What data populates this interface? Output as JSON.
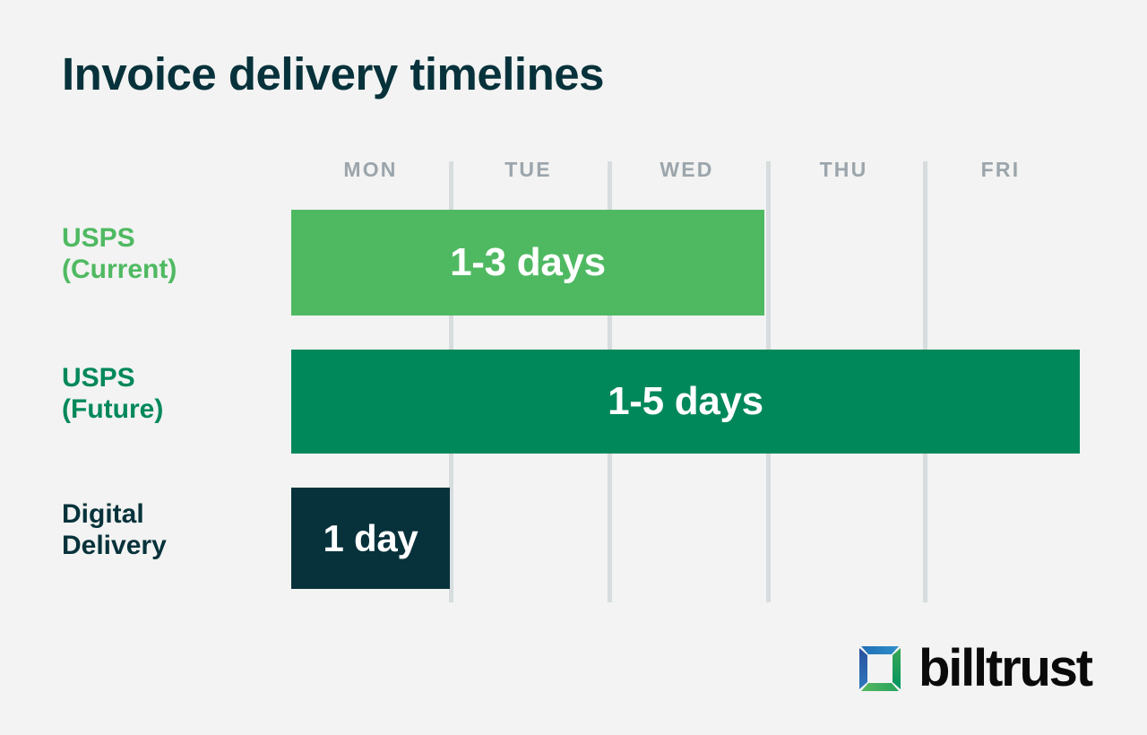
{
  "title": "Invoice delivery timelines",
  "colors": {
    "background": "#f2f3f2",
    "title_text": "#07323b",
    "gridline": "#d7dcde",
    "day_label": "#9ba5ab",
    "usps_current": "#4fb962",
    "usps_future": "#00885a",
    "digital_delivery": "#07323b",
    "bar_text": "#ffffff",
    "logo_blue": "#2b6cb8",
    "logo_green": "#3fae54"
  },
  "logo": {
    "mark_name": "billtrust-logo-mark",
    "wordmark": "billtrust"
  },
  "chart_data": {
    "type": "bar",
    "orientation": "horizontal",
    "title": "Invoice delivery timelines",
    "xlabel": "",
    "ylabel": "",
    "grid": true,
    "legend": "none",
    "categories": [
      "MON",
      "TUE",
      "WED",
      "THU",
      "FRI"
    ],
    "x_axis_ticks": [
      "MON",
      "TUE",
      "WED",
      "THU",
      "FRI"
    ],
    "series": [
      {
        "name": "USPS (Current)",
        "label": "USPS\n(Current)",
        "value_label": "1-3 days",
        "start_day": "MON",
        "end_day": "WED",
        "days_min": 1,
        "days_max": 3,
        "span_days": 3,
        "color": "#4fb962"
      },
      {
        "name": "USPS (Future)",
        "label": "USPS\n(Future)",
        "value_label": "1-5 days",
        "start_day": "MON",
        "end_day": "FRI",
        "days_min": 1,
        "days_max": 5,
        "span_days": 5,
        "color": "#00885a"
      },
      {
        "name": "Digital Delivery",
        "label": "Digital\nDelivery",
        "value_label": "1 day",
        "start_day": "MON",
        "end_day": "MON",
        "days_min": 1,
        "days_max": 1,
        "span_days": 1,
        "color": "#07323b"
      }
    ]
  }
}
